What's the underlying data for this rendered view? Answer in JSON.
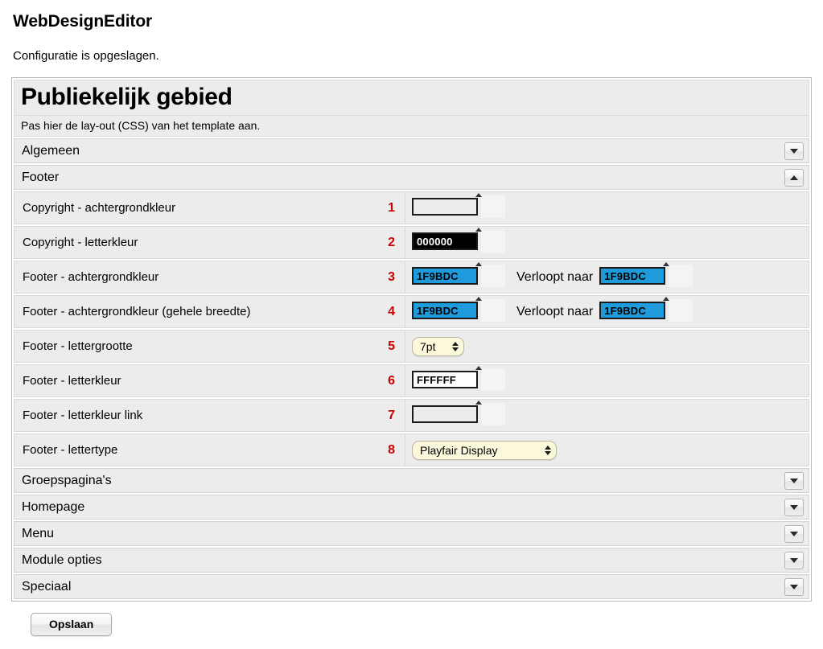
{
  "app": {
    "title": "WebDesignEditor",
    "status_message": "Configuratie is opgeslagen."
  },
  "panel": {
    "title": "Publiekelijk gebied",
    "subtitle": "Pas hier de lay-out (CSS) van het template aan."
  },
  "sections": {
    "algemeen": {
      "label": "Algemeen",
      "toggle_icon": "chevron-down-icon",
      "expanded": false
    },
    "footer": {
      "label": "Footer",
      "toggle_icon": "chevron-up-icon",
      "expanded": true
    },
    "collapsed": [
      {
        "label": "Groepspagina's",
        "toggle_icon": "chevron-down-icon"
      },
      {
        "label": "Homepage",
        "toggle_icon": "chevron-down-icon"
      },
      {
        "label": "Menu",
        "toggle_icon": "chevron-down-icon"
      },
      {
        "label": "Module opties",
        "toggle_icon": "chevron-down-icon"
      },
      {
        "label": "Speciaal",
        "toggle_icon": "chevron-down-icon"
      }
    ]
  },
  "gradient_label": "Verloopt naar",
  "fields": [
    {
      "num": "1",
      "label": "Copyright - achtergrondkleur",
      "type": "color",
      "value": "",
      "swatch": "transparent"
    },
    {
      "num": "2",
      "label": "Copyright - letterkleur",
      "type": "color",
      "value": "000000",
      "swatch": "#000000"
    },
    {
      "num": "3",
      "label": "Footer - achtergrondkleur",
      "type": "color-gradient",
      "value": "1F9BDC",
      "swatch": "#1F9BDC",
      "value2": "1F9BDC",
      "swatch2": "#1F9BDC"
    },
    {
      "num": "4",
      "label": "Footer - achtergrondkleur (gehele breedte)",
      "type": "color-gradient",
      "value": "1F9BDC",
      "swatch": "#1F9BDC",
      "value2": "1F9BDC",
      "swatch2": "#1F9BDC"
    },
    {
      "num": "5",
      "label": "Footer - lettergrootte",
      "type": "select-small",
      "value": "7pt"
    },
    {
      "num": "6",
      "label": "Footer - letterkleur",
      "type": "color",
      "value": "FFFFFF",
      "swatch": "#FFFFFF"
    },
    {
      "num": "7",
      "label": "Footer - letterkleur link",
      "type": "color",
      "value": "",
      "swatch": "transparent"
    },
    {
      "num": "8",
      "label": "Footer - lettertype",
      "type": "select-large",
      "value": "Playfair Display"
    }
  ],
  "footer_actions": {
    "save_label": "Opslaan"
  },
  "colors": {
    "accent_blue": "#1F9BDC",
    "number_red": "#CC0000",
    "row_bg": "#ECECEC",
    "select_bg": "#FBF8DC"
  }
}
